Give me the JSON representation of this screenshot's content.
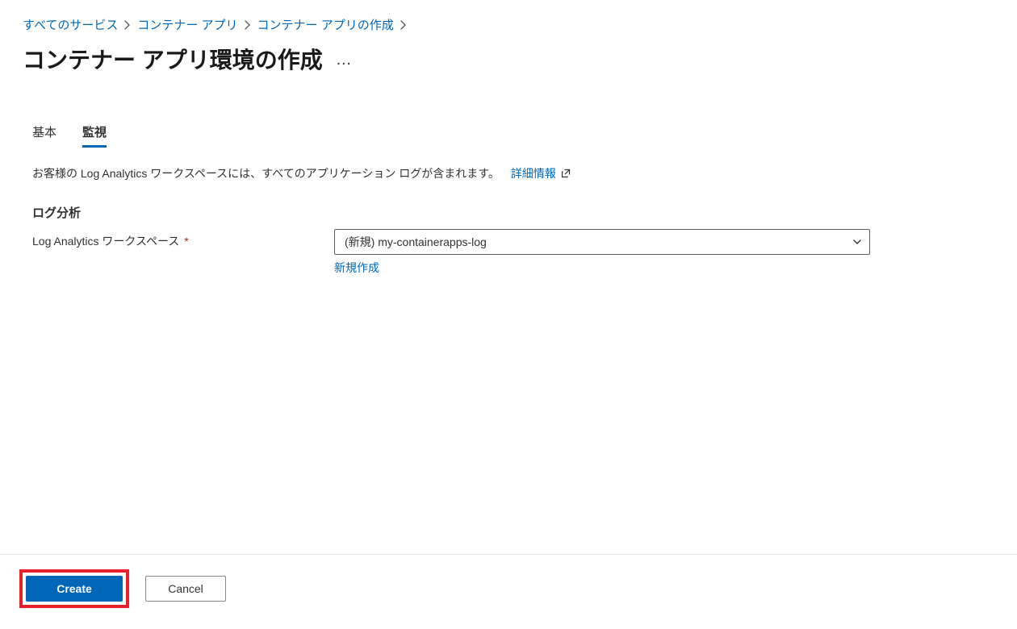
{
  "breadcrumb": {
    "items": [
      {
        "label": "すべてのサービス"
      },
      {
        "label": "コンテナー アプリ"
      },
      {
        "label": "コンテナー アプリの作成"
      }
    ]
  },
  "title": "コンテナー アプリ環境の作成",
  "more_icon_label": "…",
  "tabs": [
    {
      "label": "基本",
      "active": false
    },
    {
      "label": "監視",
      "active": true
    }
  ],
  "description": "お客様の Log Analytics ワークスペースには、すべてのアプリケーション ログが含まれます。",
  "learn_more_label": "詳細情報",
  "section_heading": "ログ分析",
  "workspace_field": {
    "label": "Log Analytics ワークスペース",
    "required_mark": "*",
    "selected_value": "(新規) my-containerapps-log",
    "create_new_label": "新規作成"
  },
  "footer": {
    "create_label": "Create",
    "cancel_label": "Cancel"
  }
}
